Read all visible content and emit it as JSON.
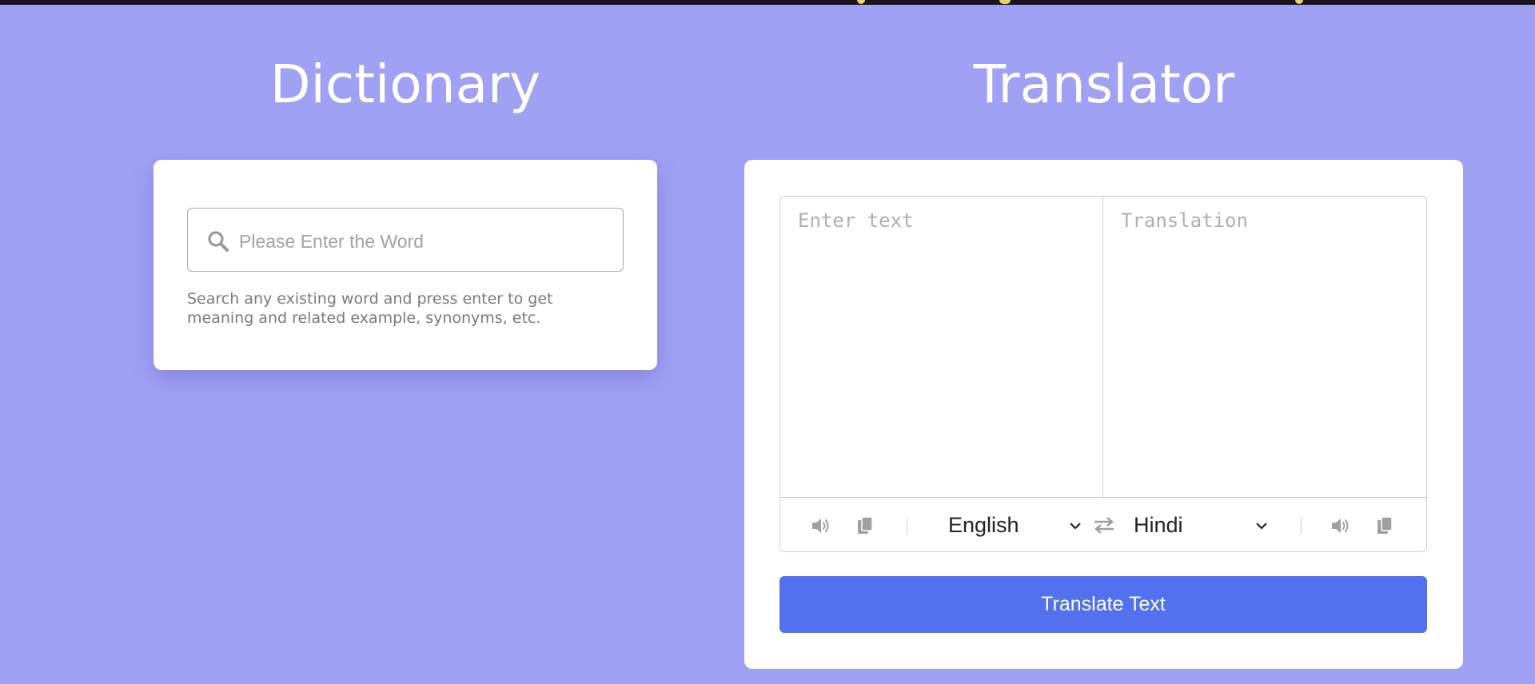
{
  "dictionary": {
    "title": "Dictionary",
    "search_placeholder": "Please Enter the Word",
    "search_value": "",
    "help_text": "Search any existing word and press enter to get meaning and related example, synonyms, etc."
  },
  "translator": {
    "title": "Translator",
    "source_placeholder": "Enter text",
    "target_placeholder": "Translation",
    "source_language": "English",
    "target_language": "Hindi",
    "button_label": "Translate Text"
  },
  "colors": {
    "background": "#a0a1f5",
    "card": "#ffffff",
    "button": "#5271ee",
    "icon_gray": "#a0a0a0"
  },
  "icons": [
    "search-icon",
    "speaker-icon",
    "copy-icon",
    "chevron-down-icon",
    "swap-icon"
  ]
}
